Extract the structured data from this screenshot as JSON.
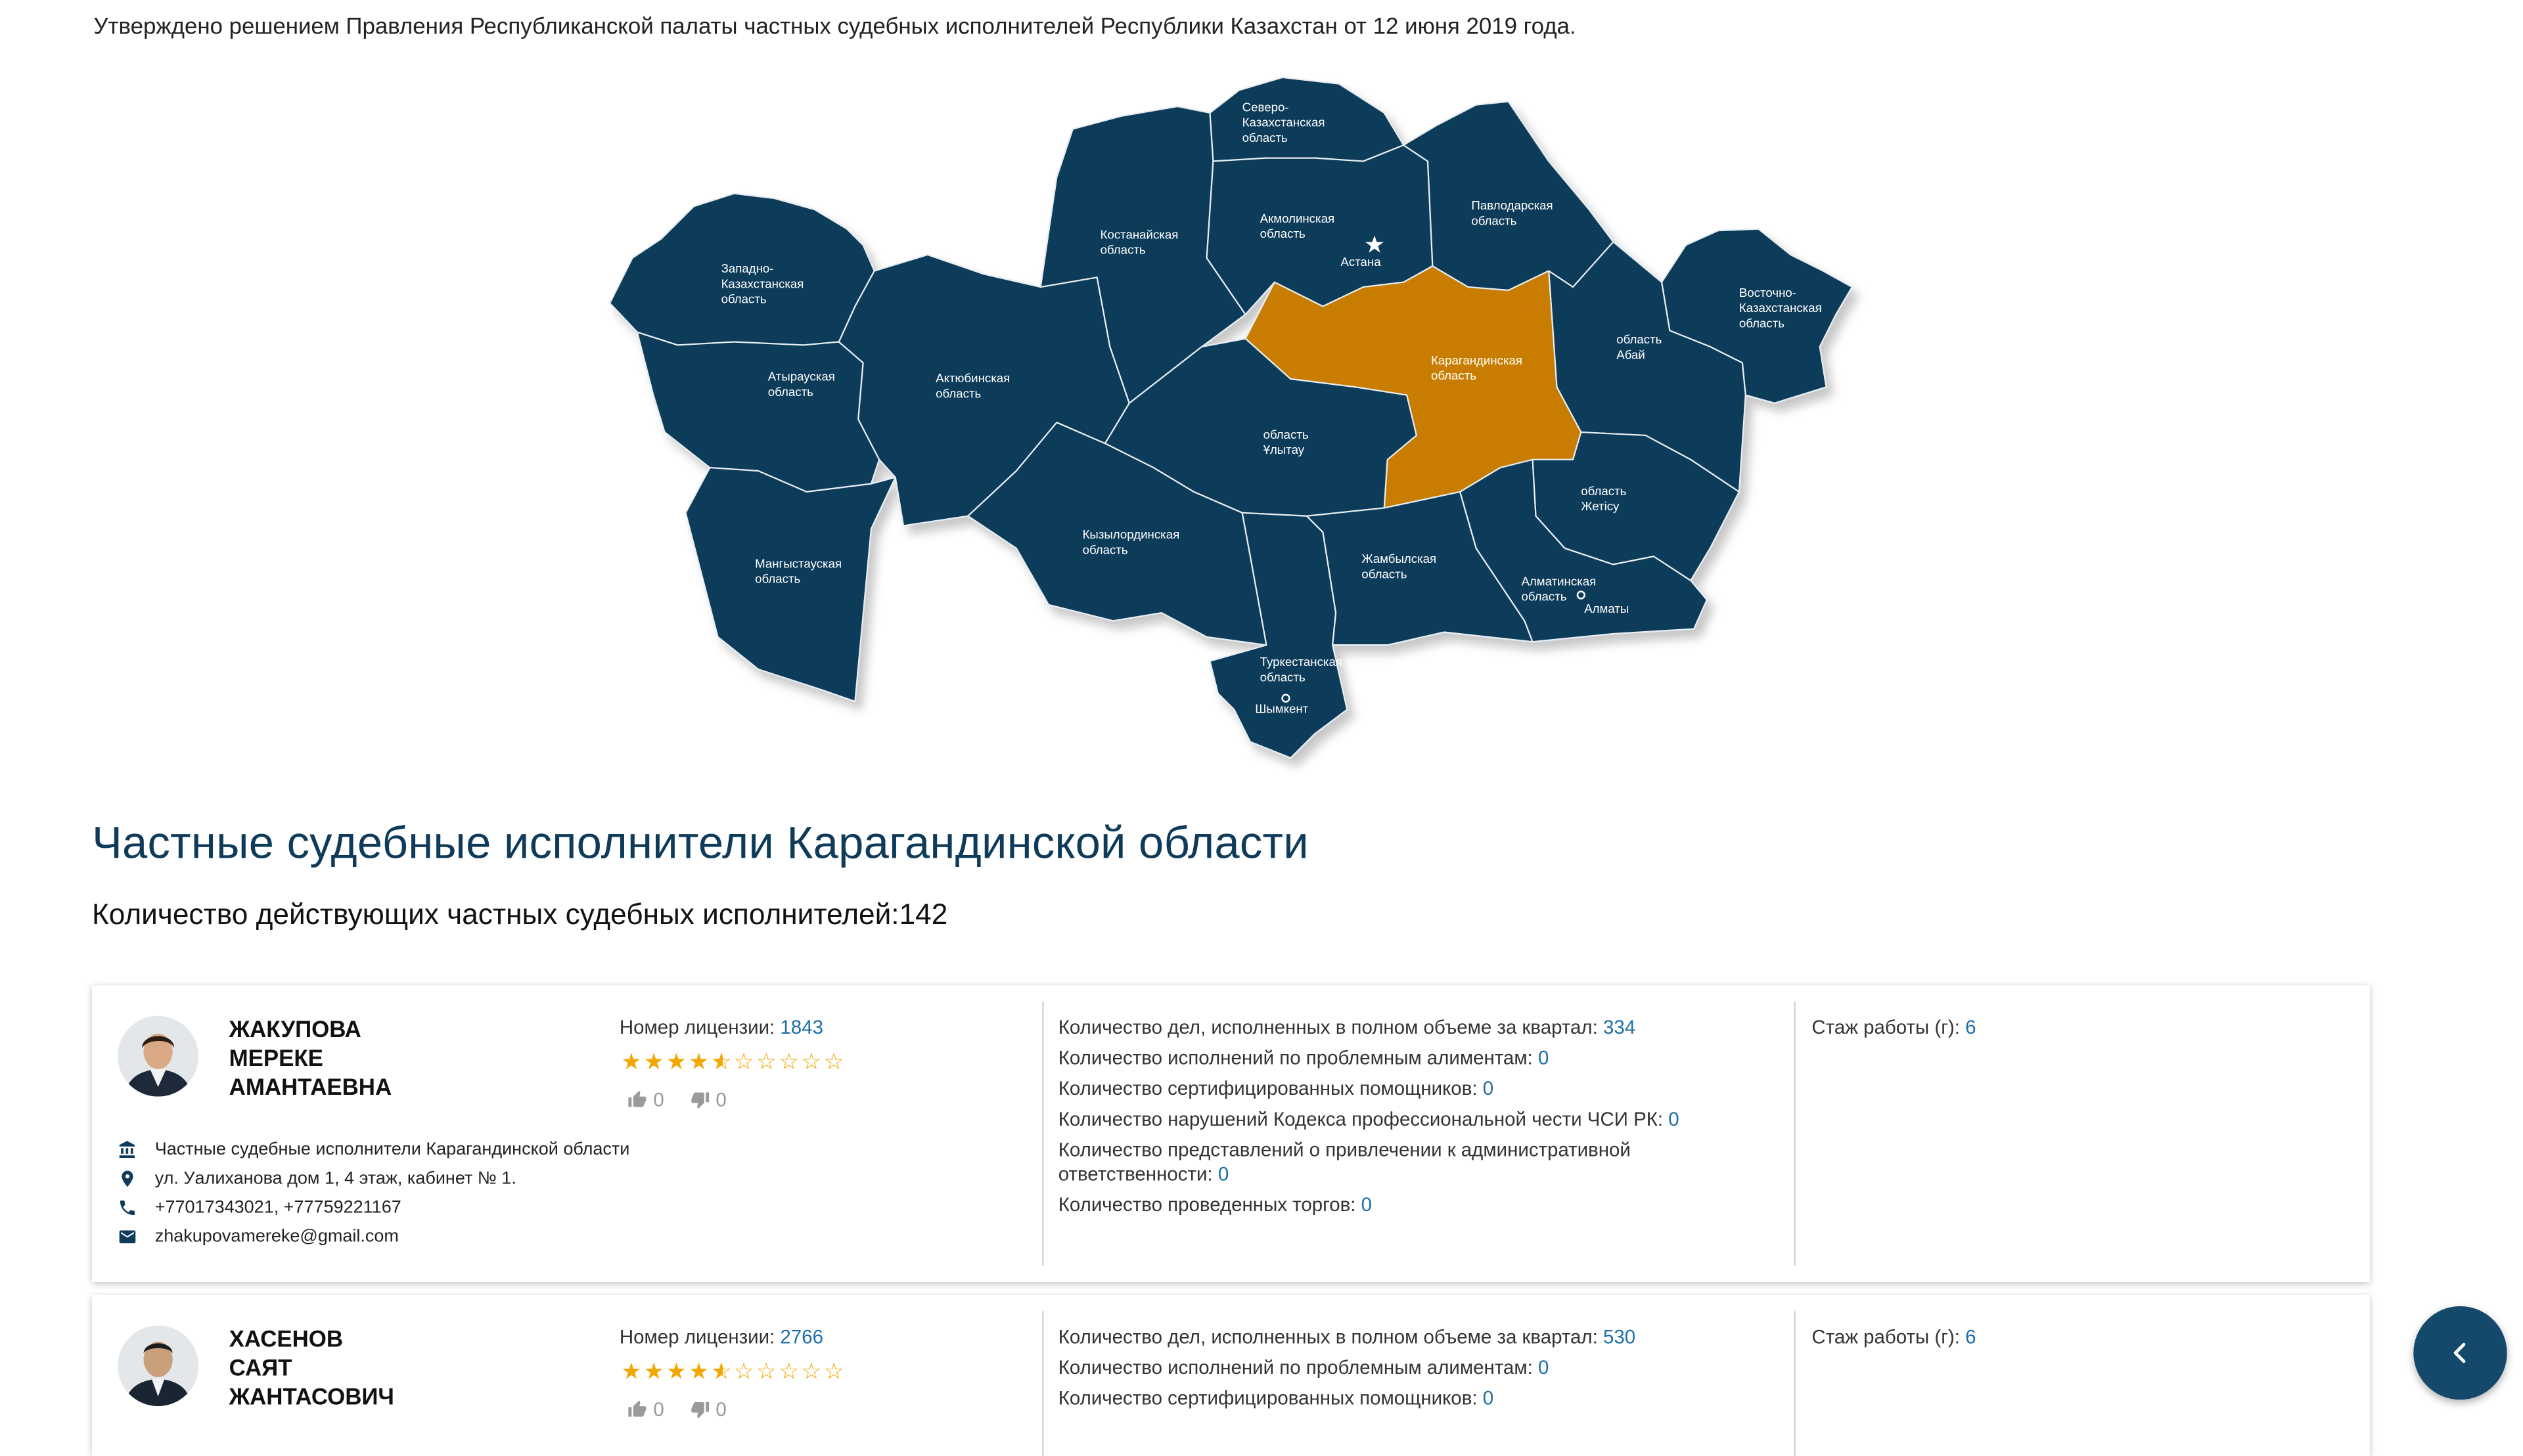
{
  "notice": "Утверждено решением Правления Республиканской палаты частных судебных исполнителей Республики Казахстан от 12 июня 2019 года.",
  "map": {
    "base_color": "#0e3b5a",
    "selected_color": "#c97d00",
    "selected_region": "Карагандинская область",
    "regions": [
      {
        "id": "west-kz",
        "label": [
          "Западно-",
          "Казахстанская",
          "область"
        ]
      },
      {
        "id": "atyrau",
        "label": [
          "Атырауская",
          "область"
        ]
      },
      {
        "id": "mangystau",
        "label": [
          "Мангыстауская",
          "область"
        ]
      },
      {
        "id": "aktobe",
        "label": [
          "Актюбинская",
          "область"
        ]
      },
      {
        "id": "kostanay",
        "label": [
          "Костанайская",
          "область"
        ]
      },
      {
        "id": "north-kz",
        "label": [
          "Северо-",
          "Казахстанская",
          "область"
        ]
      },
      {
        "id": "akmola",
        "label": [
          "Акмолинская",
          "область"
        ]
      },
      {
        "id": "pavlodar",
        "label": [
          "Павлодарская",
          "область"
        ]
      },
      {
        "id": "east-kz",
        "label": [
          "Восточно-",
          "Казахстанская",
          "область"
        ]
      },
      {
        "id": "abai",
        "label": [
          "область",
          "Абай"
        ]
      },
      {
        "id": "karaganda",
        "label": [
          "Карагандинская",
          "область"
        ]
      },
      {
        "id": "ulytau",
        "label": [
          "область",
          "Ұлытау"
        ]
      },
      {
        "id": "kyzylorda",
        "label": [
          "Кызылординская",
          "область"
        ]
      },
      {
        "id": "turkestan",
        "label": [
          "Туркестанская",
          "область"
        ]
      },
      {
        "id": "zhambyl",
        "label": [
          "Жамбылская",
          "область"
        ]
      },
      {
        "id": "almaty-region",
        "label": [
          "Алматинская",
          "область"
        ]
      },
      {
        "id": "zhetisu",
        "label": [
          "область",
          "Жетісу"
        ]
      }
    ],
    "cities": {
      "astana": "Астана",
      "almaty": "Алматы",
      "shymkent": "Шымкент"
    }
  },
  "page_title": "Частные судебные исполнители Карагандинской области",
  "count": {
    "label": "Количество действующих частных судебных исполнителей:",
    "value": "142"
  },
  "labels": {
    "license": "Номер лицензии: ",
    "cases": "Количество дел, исполненных в полном объеме за квартал: ",
    "alimony": "Количество исполнений по проблемным алиментам: ",
    "assistants": "Количество сертифицированных помощников: ",
    "violations": "Количество нарушений Кодекса профессиональной чести ЧСИ РК: ",
    "admin": "Количество представлений о привлечении к административной ответственности: ",
    "auctions": "Количество проведенных торгов: ",
    "experience": "Стаж работы (г): "
  },
  "executors": [
    {
      "name": [
        "ЖАКУПОВА",
        "МЕРЕКЕ",
        "АМАНТАЕВНА"
      ],
      "license": "1843",
      "rating": 4.5,
      "likes": "0",
      "dislikes": "0",
      "office": "Частные судебные исполнители Карагандинской области",
      "address": "ул. Уалиханова дом 1, 4 этаж, кабинет № 1.",
      "phone": "+77017343021, +77759221167",
      "email": "zhakupovamereke@gmail.com",
      "cases": "334",
      "alimony": "0",
      "assistants": "0",
      "violations": "0",
      "admin": "0",
      "auctions": "0",
      "experience": "6"
    },
    {
      "name": [
        "ХАСЕНОВ",
        "САЯТ",
        "ЖАНТАСОВИЧ"
      ],
      "license": "2766",
      "rating": 4.5,
      "likes": "0",
      "dislikes": "0",
      "cases": "530",
      "alimony": "0",
      "assistants": "0",
      "experience": "6"
    }
  ],
  "icons": {
    "office": "bank-icon",
    "address": "pin-icon",
    "phone": "phone-icon",
    "email": "mail-icon",
    "like": "thumb-up-icon",
    "dislike": "thumb-down-icon",
    "back": "chevron-left-icon"
  }
}
